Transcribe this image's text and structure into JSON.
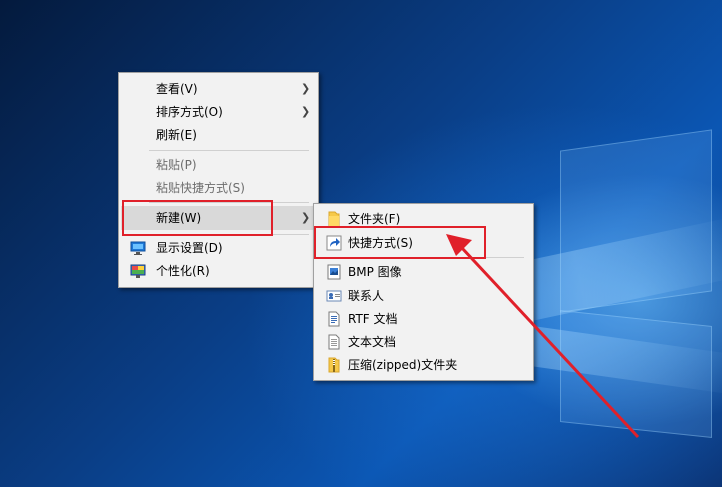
{
  "colors": {
    "menu_bg": "#f2f2f2",
    "highlight": "#d9d9d9",
    "annotation_red": "#e0202a",
    "disabled_text": "#6d6d6d"
  },
  "context_menu": {
    "items": [
      {
        "label": "查看(V)",
        "submenu": true,
        "enabled": true
      },
      {
        "label": "排序方式(O)",
        "submenu": true,
        "enabled": true
      },
      {
        "label": "刷新(E)",
        "enabled": true
      },
      {
        "label": "粘贴(P)",
        "enabled": false
      },
      {
        "label": "粘贴快捷方式(S)",
        "enabled": false
      },
      {
        "label": "新建(W)",
        "submenu": true,
        "enabled": true,
        "highlighted": true
      },
      {
        "label": "显示设置(D)",
        "icon": "display-settings-icon",
        "enabled": true
      },
      {
        "label": "个性化(R)",
        "icon": "personalize-icon",
        "enabled": true
      }
    ]
  },
  "new_submenu": {
    "items": [
      {
        "label": "文件夹(F)",
        "icon": "folder-icon"
      },
      {
        "label": "快捷方式(S)",
        "icon": "shortcut-icon"
      },
      {
        "label": "BMP 图像",
        "icon": "bitmap-image-icon"
      },
      {
        "label": "联系人",
        "icon": "contact-card-icon"
      },
      {
        "label": "RTF 文档",
        "icon": "rtf-document-icon"
      },
      {
        "label": "文本文档",
        "icon": "text-document-icon"
      },
      {
        "label": "压缩(zipped)文件夹",
        "icon": "zip-folder-icon"
      }
    ]
  }
}
